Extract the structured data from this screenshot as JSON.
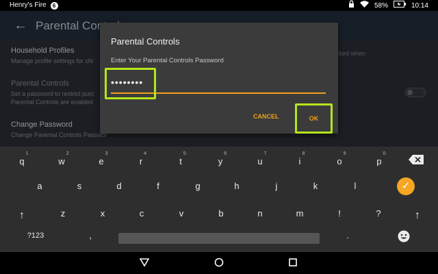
{
  "status_bar": {
    "profile_name": "Henry's Fire",
    "notification_count": "6",
    "battery": "58%",
    "time": "10:14",
    "icons": [
      "lock-icon",
      "wifi-icon",
      "battery-charging-icon"
    ]
  },
  "app": {
    "title": "Parental Controls",
    "settings": [
      {
        "title": "Household Profiles",
        "subtitle": "Manage profile settings for chi"
      },
      {
        "title": "Parental Controls",
        "subtitle_line1": "Set a password to restrict purc",
        "subtitle_line2": "Parental Controls are enabled",
        "extra": "is blocked when"
      },
      {
        "title": "Change Password",
        "subtitle": "Change Parental Controls Passwor"
      }
    ]
  },
  "dialog": {
    "title": "Parental Controls",
    "prompt": "Enter Your Parental Controls Password",
    "password_masked": "••••••••",
    "cancel_label": "CANCEL",
    "ok_label": "OK",
    "accent_color": "#f0a11a",
    "highlight_color": "#b5e61d"
  },
  "keyboard": {
    "row1": [
      {
        "k": "q",
        "h": "1"
      },
      {
        "k": "w",
        "h": "2"
      },
      {
        "k": "e",
        "h": "3"
      },
      {
        "k": "r",
        "h": "4"
      },
      {
        "k": "t",
        "h": "5"
      },
      {
        "k": "y",
        "h": "6"
      },
      {
        "k": "u",
        "h": "7"
      },
      {
        "k": "i",
        "h": "8"
      },
      {
        "k": "o",
        "h": "9"
      },
      {
        "k": "p",
        "h": "0"
      }
    ],
    "row2": [
      "a",
      "s",
      "d",
      "f",
      "g",
      "h",
      "j",
      "k",
      "l"
    ],
    "row3": [
      "z",
      "x",
      "c",
      "v",
      "b",
      "n",
      "m",
      "!",
      "?"
    ],
    "row4_left": "?123",
    "comma": ",",
    "period": ".",
    "enter_color": "#f5a623"
  }
}
